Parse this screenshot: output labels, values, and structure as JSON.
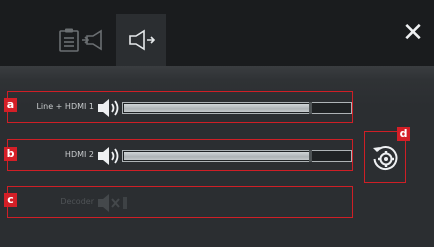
{
  "tabs": [
    {
      "id": "tab-presets",
      "icon": "clipboard-icon",
      "active": false
    },
    {
      "id": "tab-input",
      "icon": "audio-input-icon",
      "active": false
    },
    {
      "id": "tab-output",
      "icon": "speaker-output-icon",
      "active": true
    }
  ],
  "close_icon": "✕",
  "rows": [
    {
      "callout": "a",
      "label": "Line + HDMI 1",
      "level": 0.82,
      "enabled": true
    },
    {
      "callout": "b",
      "label": "HDMI 2",
      "level": 0.82,
      "enabled": true
    },
    {
      "callout": "c",
      "label": "Decoder",
      "enabled": false
    }
  ],
  "settings": {
    "callout": "d",
    "icon": "gear-reset-icon"
  },
  "colors": {
    "callout": "#d41f27",
    "outline": "#cf1f26",
    "accent": "#eef0f2"
  }
}
